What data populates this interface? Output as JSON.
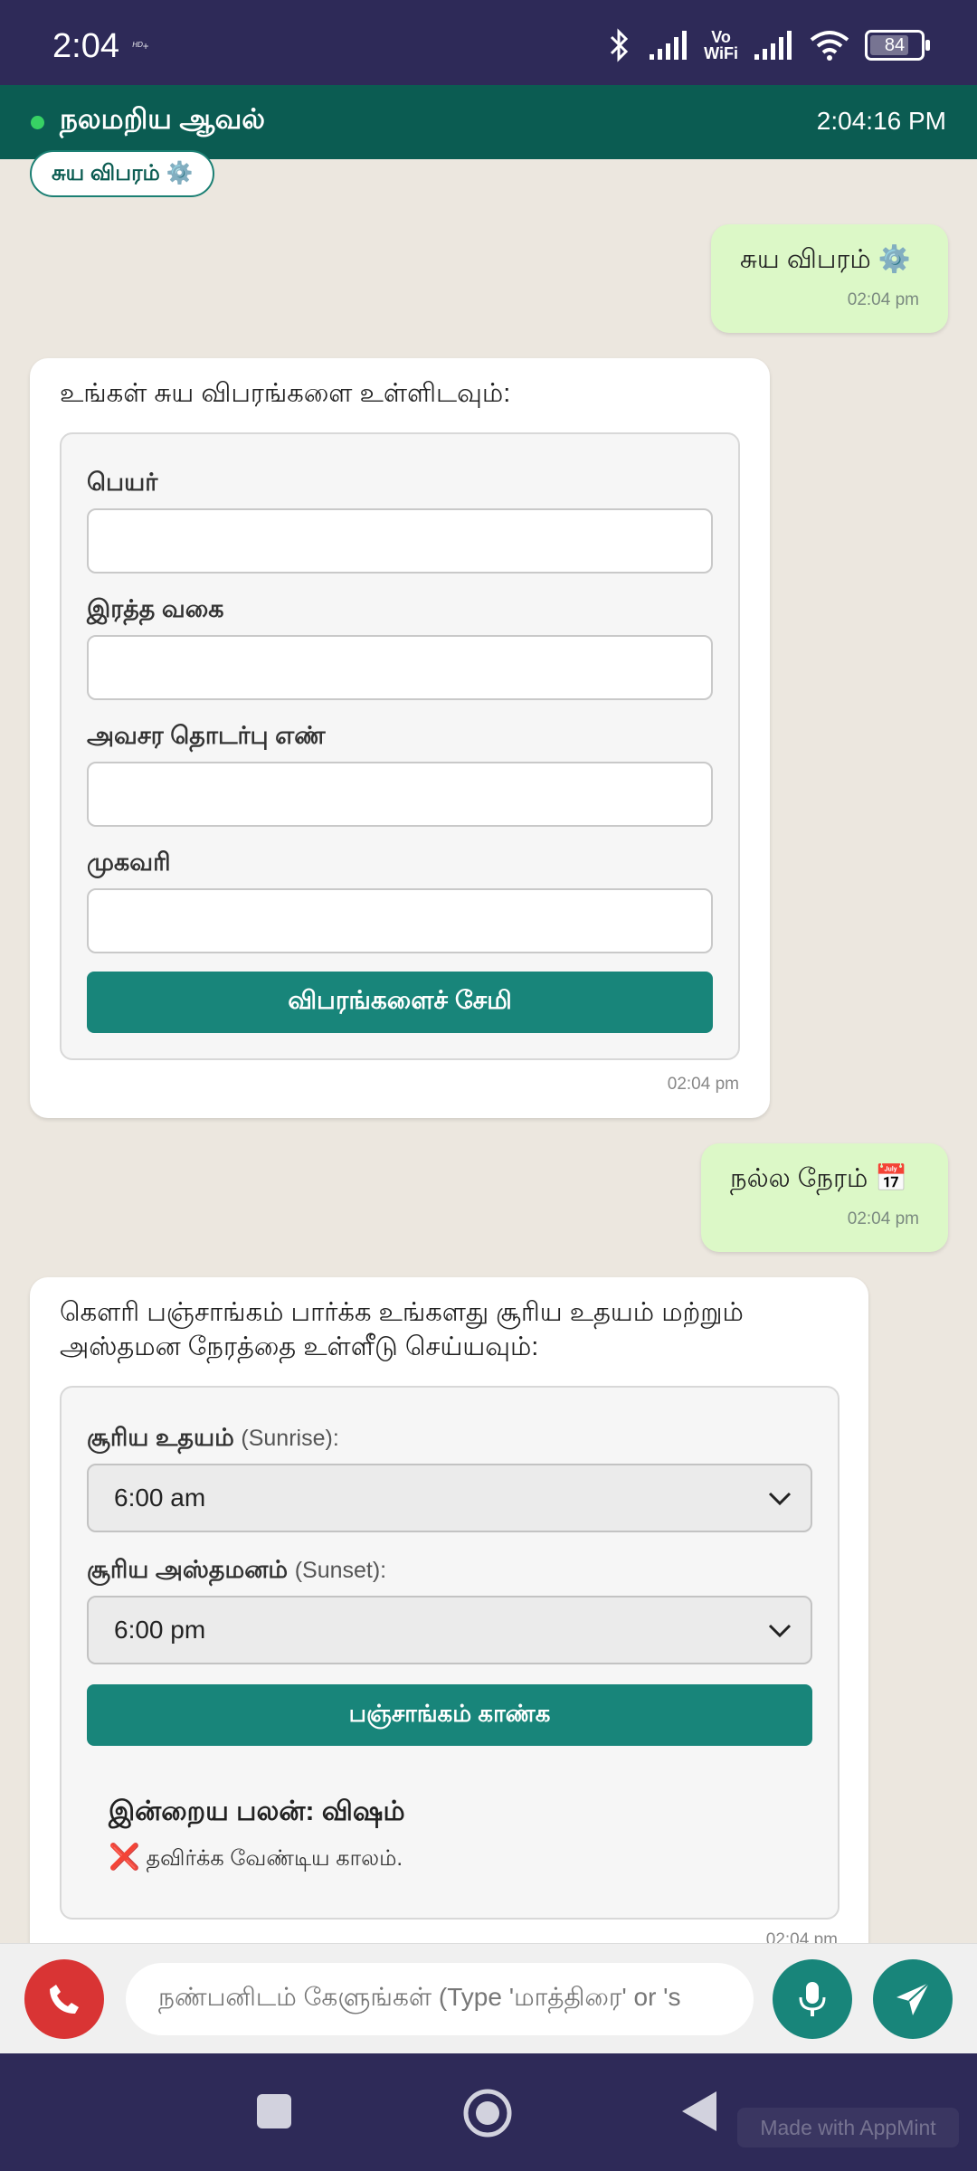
{
  "status_bar": {
    "time": "2:04",
    "carrier_tag": "ᴴᴰ+",
    "vowifi_top": "Vo",
    "vowifi_bottom": "WiFi",
    "battery": "84"
  },
  "header": {
    "title": "நலமறிய ஆவல்",
    "clock": "2:04:16 PM",
    "status_color": "#37d264"
  },
  "chip": {
    "label": "சுய விபரம் ⚙️"
  },
  "messages": {
    "out1": {
      "text": "சுய விபரம் ⚙️",
      "time": "02:04 pm"
    },
    "in1": {
      "prompt": "உங்கள் சுய விபரங்களை உள்ளிடவும்:",
      "fields": [
        {
          "label": "பெயர்",
          "value": ""
        },
        {
          "label": "இரத்த வகை",
          "value": ""
        },
        {
          "label": "அவசர தொடர்பு எண்",
          "value": ""
        },
        {
          "label": "முகவரி",
          "value": ""
        }
      ],
      "button": "விபரங்களைச் சேமி",
      "time": "02:04 pm"
    },
    "out2": {
      "text": "நல்ல நேரம் 📅",
      "time": "02:04 pm"
    },
    "in2": {
      "prompt_line1": "கௌரி பஞ்சாங்கம் பார்க்க உங்களது சூரிய உதயம் மற்றும்",
      "prompt_line2": "அஸ்தமன நேரத்தை உள்ளீடு செய்யவும்:",
      "sunrise_label": "சூரிய உதயம்",
      "sunrise_en": "(Sunrise):",
      "sunrise_value": "6:00 am",
      "sunset_label": "சூரிய அஸ்தமனம்",
      "sunset_en": "(Sunset):",
      "sunset_value": "6:00 pm",
      "button": "பஞ்சாங்கம் காண்க",
      "result_title": "இன்றைய பலன்: விஷம்",
      "result_icon": "❌",
      "result_text": "தவிர்க்க வேண்டிய காலம்.",
      "time": "02:04 pm"
    }
  },
  "composer": {
    "placeholder": "நண்பனிடம் கேளுங்கள் (Type 'மாத்திரை' or 's"
  },
  "watermark": "Made with AppMint",
  "colors": {
    "status_bar": "#2e2a58",
    "header": "#0b5c52",
    "accent": "#18857a",
    "outgoing_bubble": "#dcf8c7",
    "call": "#d93434"
  }
}
